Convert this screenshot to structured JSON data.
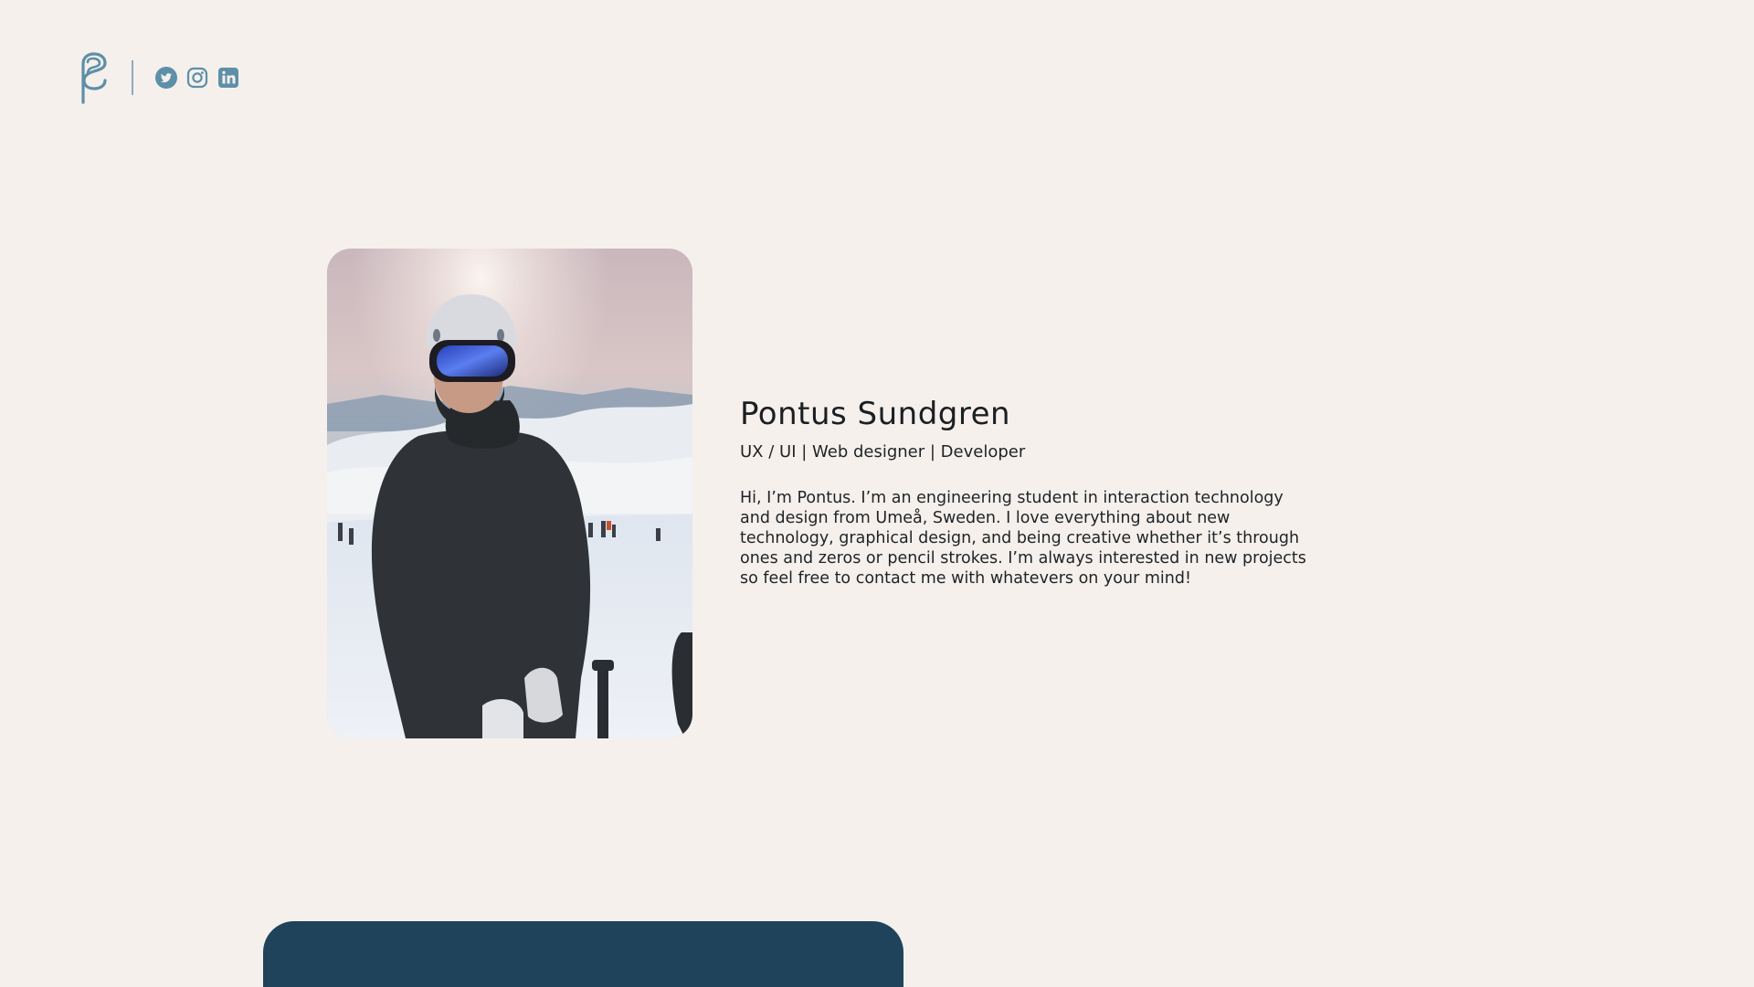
{
  "header": {
    "logo": {
      "icon": "ps-monogram-logo",
      "color": "#5e8fa8"
    },
    "social": [
      {
        "name": "twitter",
        "icon": "twitter-icon",
        "color": "#5e8fa8"
      },
      {
        "name": "instagram",
        "icon": "instagram-icon",
        "color": "#5e8fa8"
      },
      {
        "name": "linkedin",
        "icon": "linkedin-icon",
        "color": "#5e8fa8"
      }
    ]
  },
  "profile": {
    "name": "Pontus Sundgren",
    "tagline": "UX / UI | Web designer | Developer",
    "bio": "Hi, I’m Pontus. I’m an engineering student in interaction technology and design from Umeå, Sweden. I love everything about new technology, graphical design, and being creative whether it’s through ones and zeros or pencil strokes. I’m always interested in new projects so feel free to contact me with whatevers on your mind!",
    "photo": {
      "subject": "person-in-ski-gear-on-snowy-mountain"
    }
  },
  "colors": {
    "background": "#f5f0ec",
    "accent": "#5e8fa8",
    "card": "#1e435b",
    "text": "#1f2326"
  }
}
